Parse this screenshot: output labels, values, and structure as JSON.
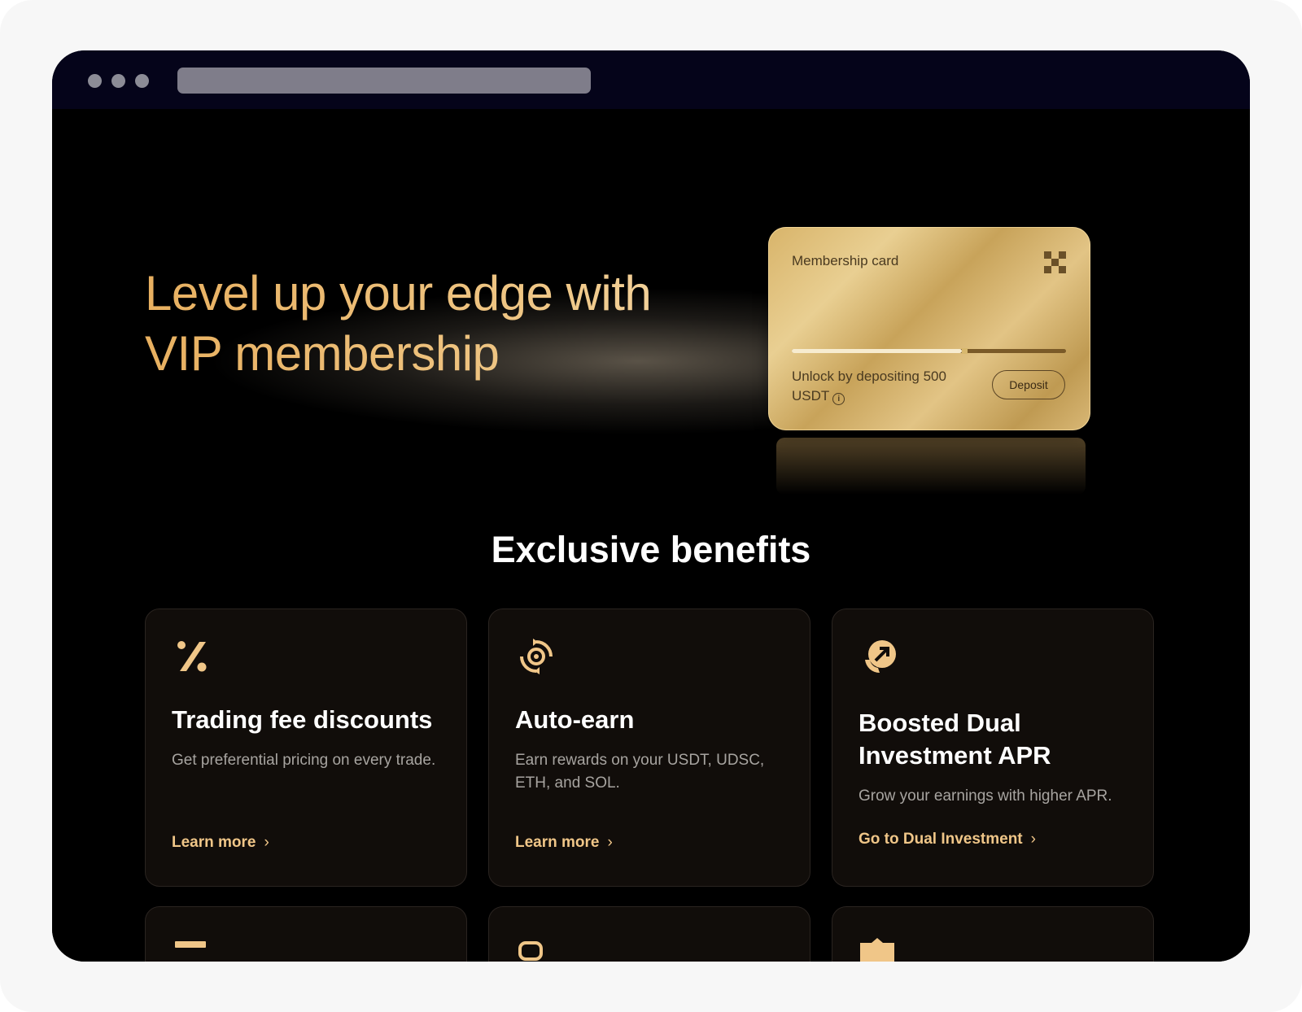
{
  "browser": {
    "window_dots": 3
  },
  "hero": {
    "title_line1": "Level up your edge with",
    "title_line2": "VIP membership"
  },
  "membership_card": {
    "label": "Membership card",
    "logo_icon": "okx-logo-icon",
    "unlock_text": "Unlock by depositing 500 USDT",
    "info_icon": "info-icon",
    "deposit_button": "Deposit",
    "progress_fraction": 0.62
  },
  "benefits": {
    "title": "Exclusive benefits",
    "items": [
      {
        "icon": "percent-icon",
        "title": "Trading fee discounts",
        "description": "Get preferential pricing on every trade.",
        "link": "Learn more"
      },
      {
        "icon": "auto-earn-icon",
        "title": "Auto-earn",
        "description": "Earn rewards on your USDT, UDSC, ETH, and SOL.",
        "link": "Learn more"
      },
      {
        "icon": "boost-arrow-icon",
        "title": "Boosted Dual Investment APR",
        "description": "Grow your earnings with higher APR.",
        "link": "Go to Dual Investment"
      }
    ],
    "partial_row_icons": [
      "bar-icon",
      "chat-icon",
      "gift-icon"
    ]
  },
  "colors": {
    "accent_gold": "#f0c688",
    "hero_gold": "#eab86c",
    "background": "#000000",
    "card_bg": "#110d0a",
    "topbar": "#05041a"
  }
}
